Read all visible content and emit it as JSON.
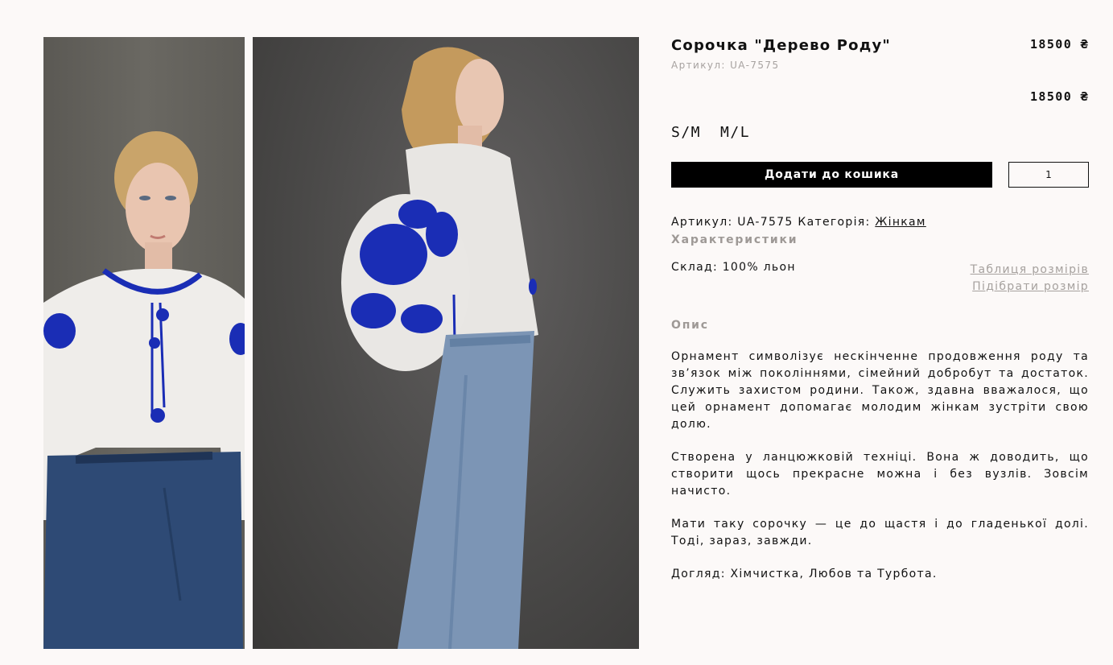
{
  "product": {
    "title": "Сорочка \"Дерево Роду\"",
    "sku_line": "Артикул: UA-7575",
    "price_top": "18500 ₴",
    "price_selected": "18500 ₴",
    "sizes": [
      "S/M",
      "M/L"
    ],
    "add_to_cart_label": "Додати до кошика",
    "quantity": "1"
  },
  "meta": {
    "sku_label": "Артикул:",
    "sku_value": "UA-7575",
    "category_label": "Категорія:",
    "category_link": "Жінкам"
  },
  "characteristics": {
    "title": "Характеристики",
    "composition": "Склад: 100% льон",
    "size_table_link": "Таблиця розмірів",
    "size_pick_link": "Підібрати розмір"
  },
  "description": {
    "title": "Опис",
    "paragraphs": [
      "Орнамент символізує нескінченне продовження роду та зв’язок між поколіннями, сімейний добробут та достаток. Служить захистом родини. Також, здавна вважалося, що цей орнамент допомагає молодим жінкам зустріти свою долю.",
      "Створена у ланцюжковій техніці. Вона ж доводить, що створити щось прекрасне можна і без вузлів. Зовсім начисто.",
      "Мати таку сорочку — це до щастя і до гладенької долі. Тоді, зараз, завжди.",
      "Догляд: Хімчистка, Любов та Турбота."
    ]
  },
  "colors": {
    "background": "#fcf9f8",
    "muted_text": "#a7a2a0",
    "button": "#000000",
    "embroidery": "#1a2db5"
  }
}
